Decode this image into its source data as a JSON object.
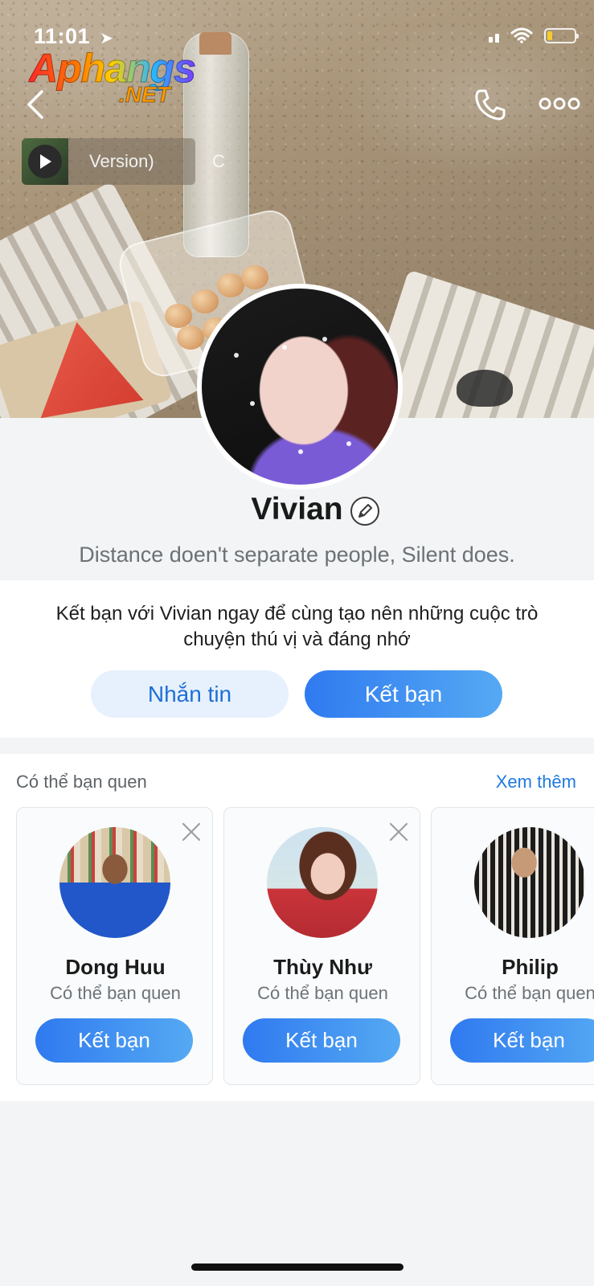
{
  "status_bar": {
    "time": "11:01",
    "battery_level": 0.2
  },
  "watermark": {
    "line1": "Aphangs",
    "line2": ".NET"
  },
  "music": {
    "title": "Version)",
    "extra": "C"
  },
  "profile": {
    "name": "Vivian",
    "status": "Distance doen't separate people, Silent does."
  },
  "add_friend": {
    "message": "Kết bạn với Vivian ngay để cùng tạo nên những cuộc trò chuyện thú vị và đáng nhớ",
    "message_button": "Nhắn tin",
    "add_button": "Kết bạn"
  },
  "suggestions": {
    "heading": "Có thể bạn quen",
    "see_more": "Xem thêm",
    "people": [
      {
        "name": "Dong Huu",
        "subtitle": "Có thể bạn quen",
        "button": "Kết bạn"
      },
      {
        "name": "Thùy Như",
        "subtitle": "Có thể bạn quen",
        "button": "Kết bạn"
      },
      {
        "name": "Philip",
        "subtitle": "Có thể bạn quen",
        "button": "Kết bạn"
      }
    ]
  },
  "colors": {
    "accent": "#2f7af0",
    "accent_light": "#e7f1fd",
    "link": "#1f7ae0",
    "battery": "#f5cc2a"
  },
  "icons": [
    "location-arrow-icon",
    "signal-icon",
    "wifi-icon",
    "battery-icon",
    "back-icon",
    "phone-icon",
    "more-icon",
    "play-icon",
    "edit-icon",
    "close-icon"
  ]
}
